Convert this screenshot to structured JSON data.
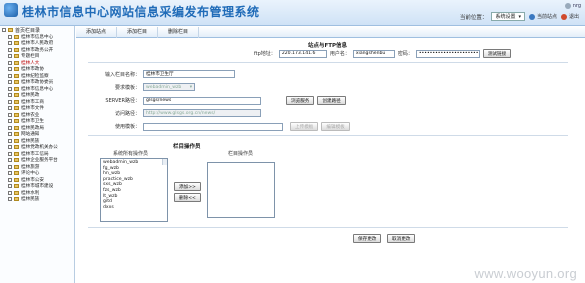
{
  "header": {
    "title": "桂林市信息中心网站信息采编发布管理系统",
    "user_label": "nrg",
    "user_sub": "",
    "location_label": "当前位置：",
    "location_value": "系统设置",
    "site_label": "当前站点",
    "quit_label": "退出"
  },
  "sidebar": {
    "root_label": "首页栏目录",
    "items": [
      {
        "label": "桂林市信息中心"
      },
      {
        "label": "桂林市人民政府"
      },
      {
        "label": "桂林市政务公开"
      },
      {
        "label": "专题栏目"
      },
      {
        "label": "桂林人大"
      },
      {
        "label": "桂林市政协"
      },
      {
        "label": "桂林纪检监察"
      },
      {
        "label": "桂林市政协委员"
      },
      {
        "label": "桂林市信息中心"
      },
      {
        "label": "桂林民政"
      },
      {
        "label": "桂林市工商"
      },
      {
        "label": "桂林市文件"
      },
      {
        "label": "桂林农业"
      },
      {
        "label": "桂林市卫生"
      },
      {
        "label": "桂林民政局"
      },
      {
        "label": "网站通知"
      },
      {
        "label": "桂林民族"
      },
      {
        "label": "桂林党政机关办公"
      },
      {
        "label": "桂林市工信局"
      },
      {
        "label": "桂林企业服务平台"
      },
      {
        "label": "桂林旅游"
      },
      {
        "label": "评论中心"
      },
      {
        "label": "桂林市公安"
      },
      {
        "label": "桂林市城市建设"
      },
      {
        "label": "桂林水利"
      },
      {
        "label": "桂林民族"
      }
    ]
  },
  "tabs": [
    {
      "label": "添加站点"
    },
    {
      "label": "添加栏目"
    },
    {
      "label": "删除栏目"
    }
  ],
  "ftp_section": {
    "title": "站点与FTP信息",
    "ftp_addr_label": "ftp地址：",
    "ftp_addr_value": "220.173.141.6",
    "user_label": "用户名：",
    "user_value": "xiangshenbu",
    "pass_label": "密码：",
    "pass_value": "••••••••••••••••••••••",
    "test_button": "测试链接"
  },
  "column_section": {
    "name_label": "输入栏目名称：",
    "name_value": "桂林市卫生厅",
    "template_label": "要求模板：",
    "template_value": "webadmin_wzb",
    "server_label": "SERVER路径：",
    "server_value": "glsgs/news",
    "view_button": "浏览服务",
    "create_button": "创建路径",
    "url_label": "访问路径：",
    "url_value": "http://www.glsgs.org.cn/news/",
    "image_label": "使用模板：",
    "image_value": "",
    "upload_button": "上传模板",
    "edit_button": "编辑模板"
  },
  "operator_section": {
    "title": "栏目操作员",
    "left_title": "系统所有操作员",
    "right_title": "栏目操作员",
    "operators": [
      "webadmin_wzb",
      "fg_wzb",
      "hn_wzb",
      "practice_wzb",
      "sxs_wzb",
      "fzs_wzb",
      "lt_wzb",
      "gitd",
      "dxxs"
    ],
    "selected": [],
    "add_button": "添加>>",
    "remove_button": "删除<<"
  },
  "footer": {
    "save_button": "保存更改",
    "cancel_button": "取消更改"
  },
  "watermark": "www.wooyun.org"
}
